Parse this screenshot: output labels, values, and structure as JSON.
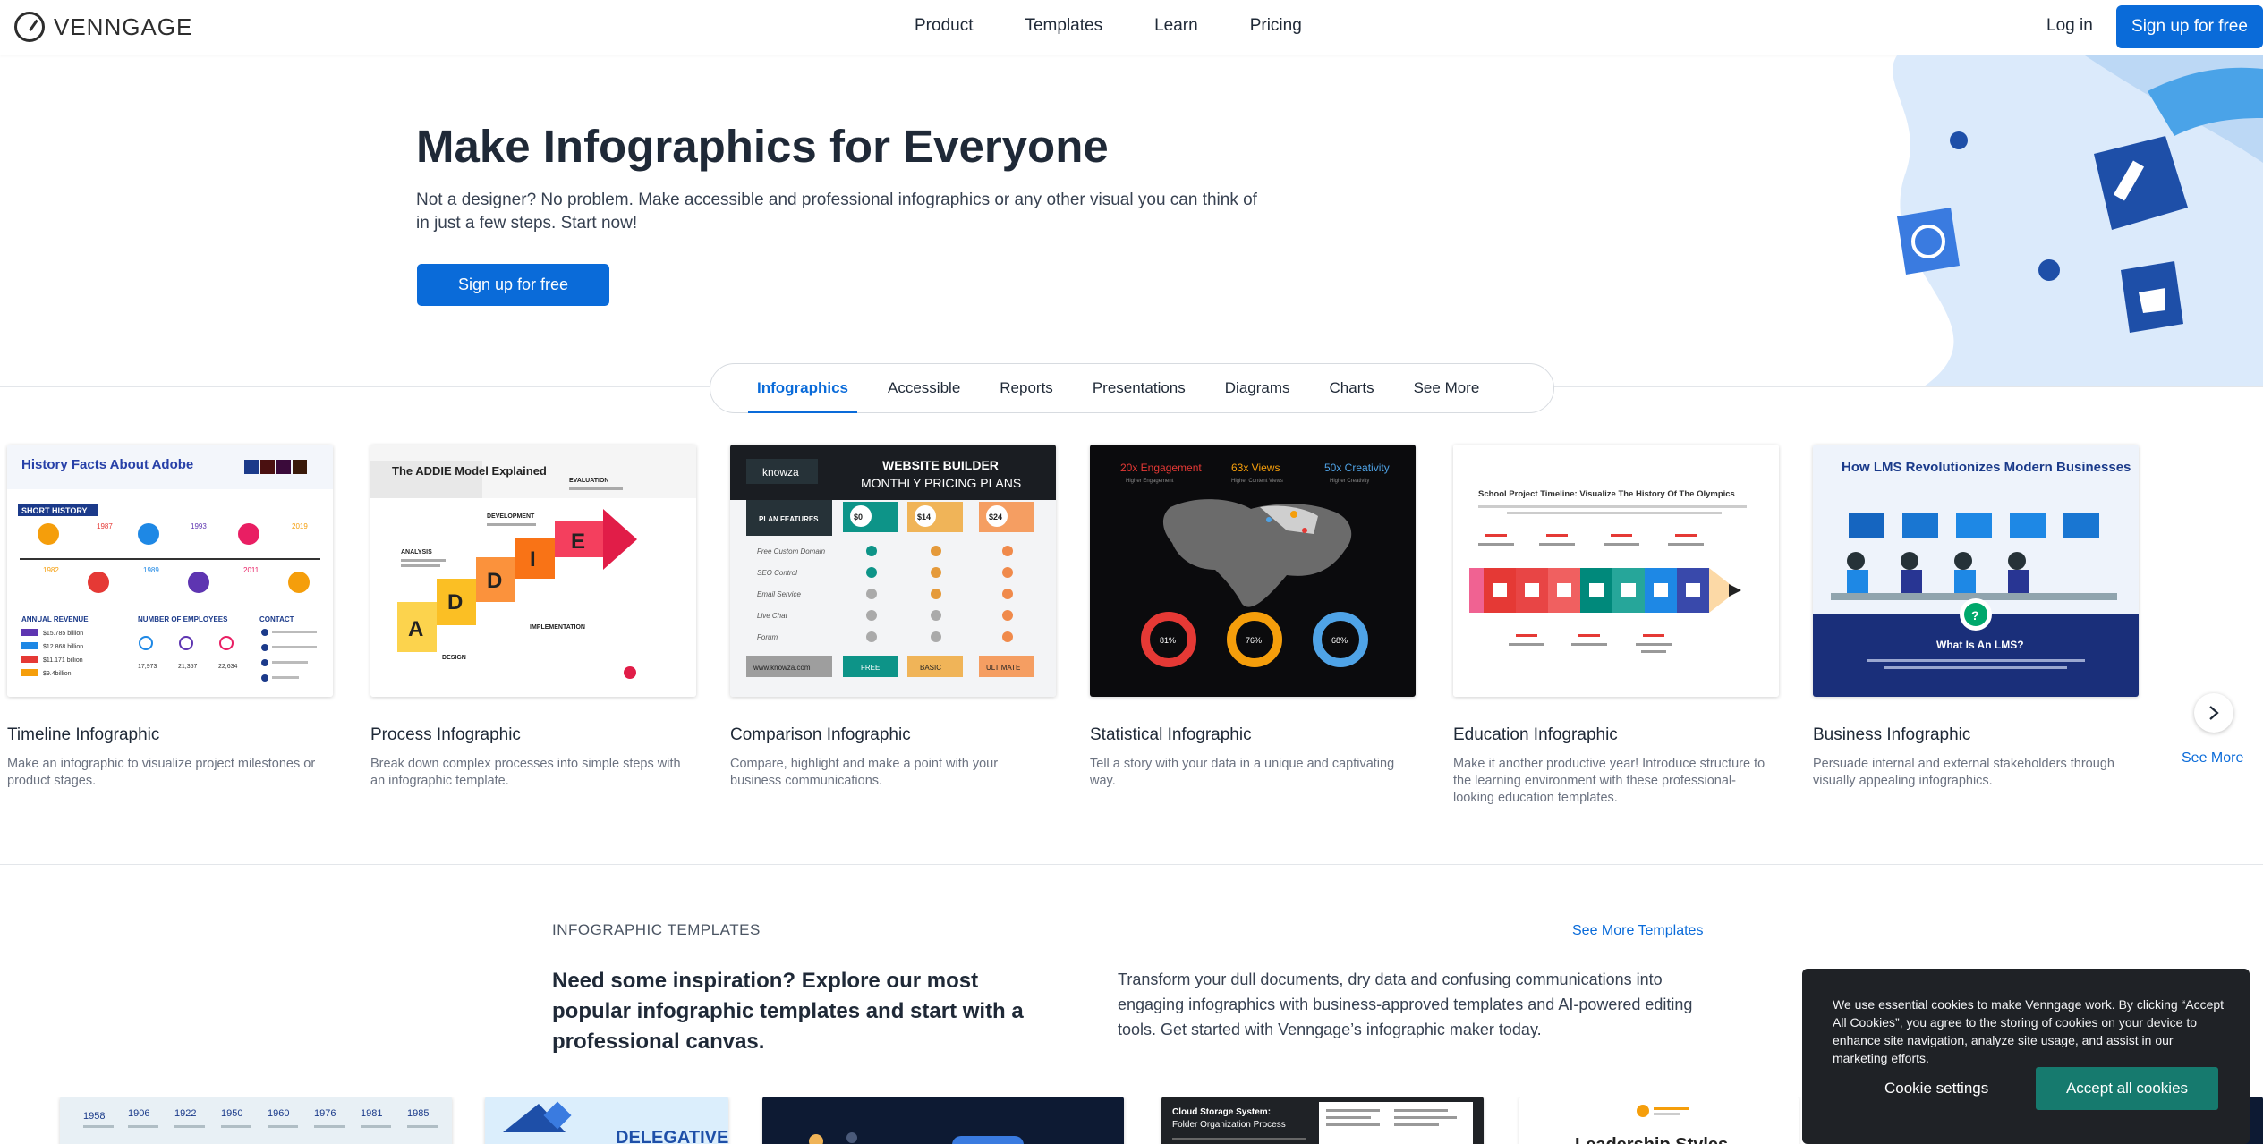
{
  "nav": {
    "logo": "VENNGAGE",
    "links": [
      "Product",
      "Templates",
      "Learn",
      "Pricing"
    ],
    "login": "Log in",
    "signup": "Sign up for free"
  },
  "hero": {
    "title": "Make Infographics for Everyone",
    "subtitle": "Not a designer? No problem. Make accessible and professional infographics or any other visual you can think of in just a few steps. Start now!",
    "cta": "Sign up for free"
  },
  "tabs": [
    "Infographics",
    "Accessible",
    "Reports",
    "Presentations",
    "Diagrams",
    "Charts",
    "See More"
  ],
  "active_tab": "Infographics",
  "cards": [
    {
      "title": "Timeline Infographic",
      "desc": "Make an infographic to visualize project milestones or product stages.",
      "thumb": {
        "heading": "History Facts About Adobe",
        "section": "SHORT HISTORY",
        "years": [
          "1987",
          "1982",
          "1993",
          "1989",
          "2011",
          "2019"
        ],
        "panels": [
          "ANNUAL REVENUE",
          "NUMBER OF EMPLOYEES",
          "CONTACT"
        ],
        "revenue": [
          "$15.785 billion",
          "$12.868 billion",
          "$11.171 billion",
          "$9.4billion"
        ],
        "employees": [
          "17,973",
          "21,357",
          "22,634"
        ]
      }
    },
    {
      "title": "Process Infographic",
      "desc": "Break down complex processes into simple steps with an infographic template.",
      "thumb": {
        "heading": "The ADDIE Model Explained",
        "letters": [
          "A",
          "D",
          "D",
          "I",
          "E"
        ],
        "stages": [
          "ANALYSIS",
          "DESIGN",
          "DEVELOPMENT",
          "IMPLEMENTATION",
          "EVALUATION"
        ]
      }
    },
    {
      "title": "Comparison Infographic",
      "desc": "Compare, highlight and make a point with your business communications.",
      "thumb": {
        "brand": "knowza",
        "heading": "WEBSITE BUILDER",
        "subheading": "MONTHLY PRICING PLANS",
        "features_label": "PLAN FEATURES",
        "prices": [
          "$0",
          "$14",
          "$24"
        ],
        "features": [
          "Free Custom Domain",
          "SEO Control",
          "Email Service",
          "Live Chat",
          "Forum"
        ],
        "url": "www.knowza.com",
        "plans": [
          "FREE",
          "BASIC",
          "ULTIMATE"
        ]
      }
    },
    {
      "title": "Statistical Infographic",
      "desc": "Tell a story with your data in a unique and captivating way.",
      "thumb": {
        "stats": [
          "20x Engagement",
          "63x Views",
          "50x Creativity"
        ],
        "stat_subs": [
          "Higher Engagement",
          "Higher Content Views",
          "Higher Creativity"
        ],
        "donuts": [
          "81%",
          "76%",
          "68%"
        ]
      }
    },
    {
      "title": "Education Infographic",
      "desc": "Make it another productive year! Introduce structure to the learning environment with these professional-looking education templates.",
      "thumb": {
        "heading": "School Project Timeline: Visualize The History Of The Olympics"
      }
    },
    {
      "title": "Business Infographic",
      "desc": "Persuade internal and external stakeholders through visually appealing infographics.",
      "thumb": {
        "heading": "How LMS Revolutionizes Modern Businesses",
        "question": "What Is An LMS?"
      }
    }
  ],
  "see_more_link": "See More",
  "templates_section": {
    "label": "INFOGRAPHIC TEMPLATES",
    "see_more": "See More Templates",
    "heading": "Need some inspiration? Explore our most popular infographic templates and start with a professional canvas.",
    "body": "Transform your dull documents, dry data and confusing communications into engaging infographics with business-approved templates and AI-powered editing tools. Get started with Venngage’s infographic maker today.",
    "tpl_years": [
      "1958",
      "1906",
      "1922",
      "1950",
      "1960",
      "1976",
      "1981",
      "1985"
    ],
    "tpl2_text": "DELEGATIVE",
    "tpl4_title": "Cloud Storage System:",
    "tpl4_sub": "Folder Organization Process",
    "tpl5_text": "Leadership Styles"
  },
  "cookie": {
    "text": "We use essential cookies to make Venngage work. By clicking “Accept All Cookies”, you agree to the storing of cookies on your device to enhance site navigation, analyze site usage, and assist in our marketing efforts.",
    "settings": "Cookie settings",
    "accept": "Accept all cookies"
  },
  "colors": {
    "primary": "#0a6bd9",
    "cookie_bg": "#1f2226",
    "cookie_accept": "#167a6e"
  }
}
